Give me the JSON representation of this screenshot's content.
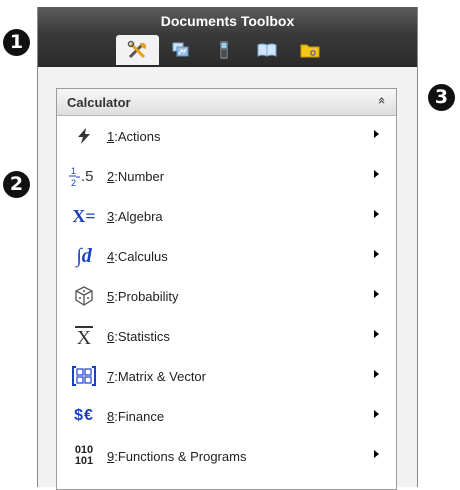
{
  "callouts": [
    "1",
    "2",
    "3"
  ],
  "toolbox": {
    "title": "Documents Toolbox",
    "tabs": [
      {
        "icon": "tools-icon",
        "active": true
      },
      {
        "icon": "variables-icon",
        "active": false
      },
      {
        "icon": "handheld-icon",
        "active": false
      },
      {
        "icon": "book-icon",
        "active": false
      },
      {
        "icon": "folder-icon",
        "active": false
      }
    ]
  },
  "panel": {
    "title": "Calculator",
    "collapse_glyph": "»"
  },
  "menu": [
    {
      "key": "1",
      "label": ":Actions",
      "icon": "lightning-icon",
      "icon_text": ""
    },
    {
      "key": "2",
      "label": ":Number",
      "icon": "number-icon",
      "icon_text": ".5"
    },
    {
      "key": "3",
      "label": ":Algebra",
      "icon": "algebra-icon",
      "icon_text": "X="
    },
    {
      "key": "4",
      "label": ":Calculus",
      "icon": "calculus-icon",
      "icon_text": "∫d"
    },
    {
      "key": "5",
      "label": ":Probability",
      "icon": "dice-icon",
      "icon_text": ""
    },
    {
      "key": "6",
      "label": ":Statistics",
      "icon": "mean-icon",
      "icon_text": "X"
    },
    {
      "key": "7",
      "label": ":Matrix & Vector",
      "icon": "matrix-icon",
      "icon_text": ""
    },
    {
      "key": "8",
      "label": ":Finance",
      "icon": "finance-icon",
      "icon_text": "$€"
    },
    {
      "key": "9",
      "label": ":Functions & Programs",
      "icon": "binary-icon",
      "icon_text": "010 101"
    }
  ],
  "colors": {
    "header": "#3a3a3a",
    "accent_blue": "#1a3fc4"
  }
}
